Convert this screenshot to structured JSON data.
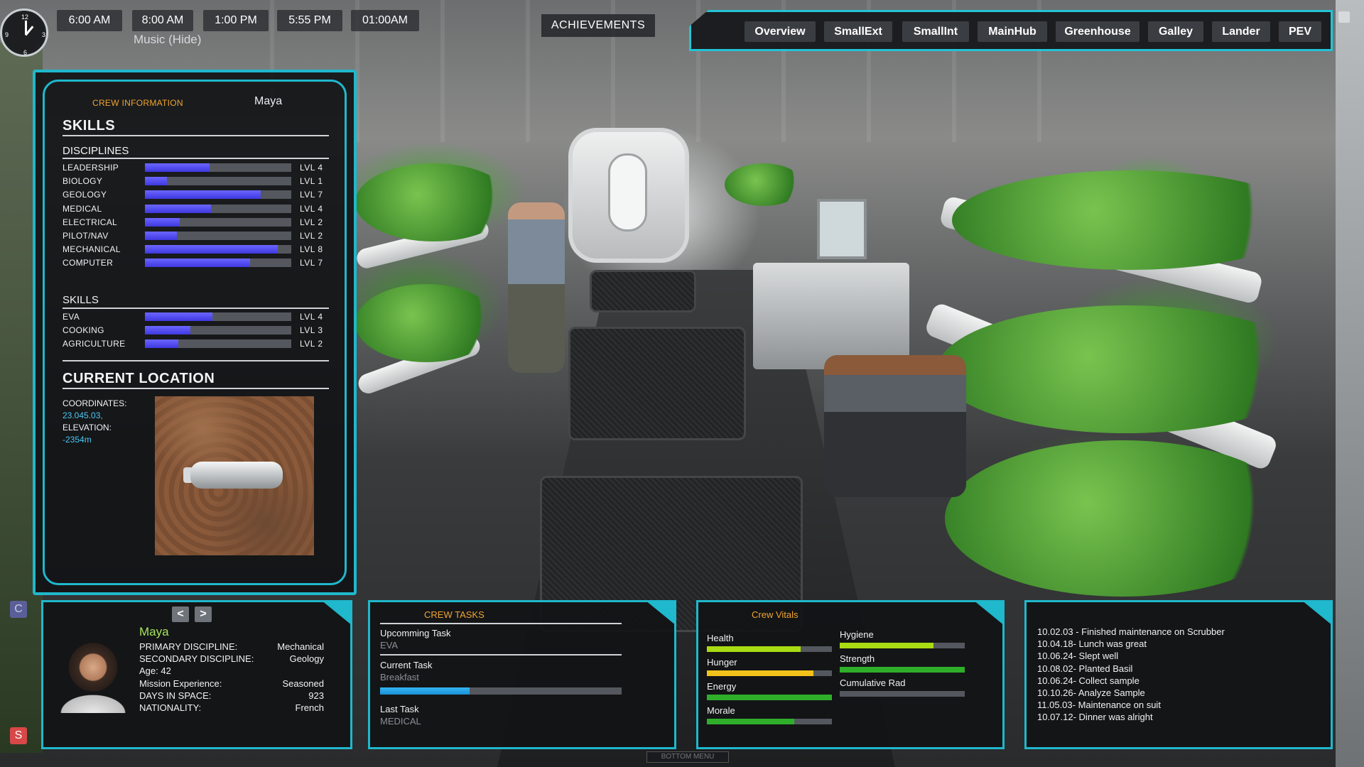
{
  "time_buttons": [
    "6:00 AM",
    "8:00 AM",
    "1:00 PM",
    "5:55 PM",
    "01:00AM"
  ],
  "clock_numbers": {
    "n12": "12",
    "n3": "3",
    "n6": "6",
    "n9": "9"
  },
  "music_label": "Music (Hide)",
  "achievements_label": "ACHIEVEMENTS",
  "nav_tabs": [
    "Overview",
    "SmallExt",
    "SmallInt",
    "MainHub",
    "Greenhouse",
    "Galley",
    "Lander",
    "PEV"
  ],
  "crew_info": {
    "title": "CREW INFORMATION",
    "name": "Maya",
    "skills_heading": "SKILLS",
    "disciplines_heading": "DISCIPLINES",
    "disciplines": [
      {
        "label": "LEADERSHIP",
        "level": "LVL 4",
        "fill": 0.44
      },
      {
        "label": "BIOLOGY",
        "level": "LVL 1",
        "fill": 0.15
      },
      {
        "label": "GEOLOGY",
        "level": "LVL 7",
        "fill": 0.79
      },
      {
        "label": "MEDICAL",
        "level": "LVL 4",
        "fill": 0.45
      },
      {
        "label": "ELECTRICAL",
        "level": "LVL 2",
        "fill": 0.24
      },
      {
        "label": "PILOT/NAV",
        "level": "LVL 2",
        "fill": 0.22
      },
      {
        "label": "MECHANICAL",
        "level": "LVL 8",
        "fill": 0.91
      },
      {
        "label": "COMPUTER",
        "level": "LVL 7",
        "fill": 0.72
      }
    ],
    "skills_sub_heading": "SKILLS",
    "skills": [
      {
        "label": "EVA",
        "level": "LVL 4",
        "fill": 0.46
      },
      {
        "label": "COOKING",
        "level": "LVL 3",
        "fill": 0.31
      },
      {
        "label": "AGRICULTURE",
        "level": "LVL 2",
        "fill": 0.23
      }
    ],
    "location_heading": "CURRENT LOCATION",
    "coordinates_label": "COORDINATES:",
    "coordinates_value": "23.045.03,",
    "elevation_label": "ELEVATION:",
    "elevation_value": "-2354m"
  },
  "side_buttons": {
    "c": "C",
    "s": "S"
  },
  "profile": {
    "prev": "<",
    "next": ">",
    "name": "Maya",
    "rows": [
      {
        "k": "PRIMARY DISCIPLINE:",
        "v": "Mechanical"
      },
      {
        "k": "SECONDARY DISCIPLINE:",
        "v": "Geology"
      },
      {
        "k": "Age: 42",
        "v": ""
      },
      {
        "k": "Mission Experience:",
        "v": "Seasoned"
      },
      {
        "k": "DAYS IN SPACE:",
        "v": "923"
      },
      {
        "k": "NATIONALITY:",
        "v": "French"
      }
    ]
  },
  "crew_tasks": {
    "title": "CREW TASKS",
    "upcoming_label": "Upcomming Task",
    "upcoming_value": "EVA",
    "current_label": "Current Task",
    "current_value": "Breakfast",
    "current_progress": 0.37,
    "last_label": "Last Task",
    "last_value": "MEDICAL"
  },
  "crew_vitals": {
    "title": "Crew Vitals",
    "items": [
      {
        "label": "Health",
        "fill": 0.75,
        "color": "#a9dc12"
      },
      {
        "label": "Hunger",
        "fill": 0.85,
        "color": "#f2c21a"
      },
      {
        "label": "Energy",
        "fill": 1.0,
        "color": "#2fae2a"
      },
      {
        "label": "Morale",
        "fill": 0.7,
        "color": "#2fae2a"
      },
      {
        "label": "Hygiene",
        "fill": 0.75,
        "color": "#a9dc12"
      },
      {
        "label": "Strength",
        "fill": 1.0,
        "color": "#2fae2a"
      },
      {
        "label": "Cumulative Rad",
        "fill": 0.0,
        "color": "#2fae2a"
      }
    ]
  },
  "log": [
    "10.02.03 - Finished maintenance on Scrubber",
    "10.04.18- Lunch was great",
    "10.06.24- Slept well",
    "10.08.02- Planted Basil",
    "10.06.24- Collect sample",
    "10.10.26- Analyze Sample",
    "11.05.03- Maintenance on suit",
    "10.07.12- Dinner was alright"
  ],
  "bottom_menu": "BOTTOM MENU",
  "colors": {
    "accent": "#1fb8cc",
    "orange_title": "#f0a531",
    "skill_bar": "#4a44f0",
    "name_green": "#a4e35a"
  }
}
